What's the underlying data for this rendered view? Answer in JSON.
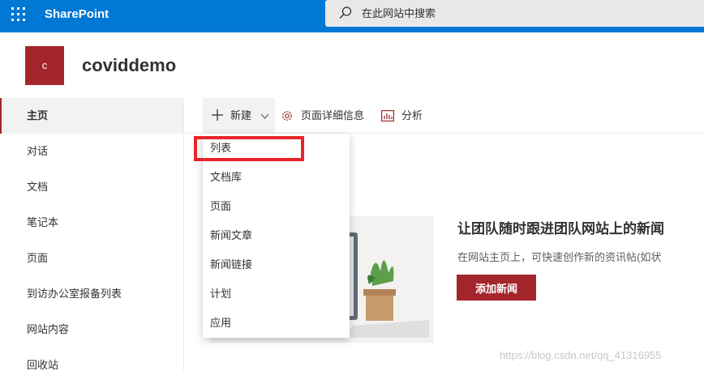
{
  "suite_bar": {
    "brand": "SharePoint",
    "search_placeholder": "在此网站中搜索",
    "accent_color": "#0078d4"
  },
  "site": {
    "logo_letter": "c",
    "title": "coviddemo",
    "theme_color": "#a4262c"
  },
  "left_nav": {
    "items": [
      {
        "label": "主页",
        "active": true
      },
      {
        "label": "对话"
      },
      {
        "label": "文档"
      },
      {
        "label": "笔记本"
      },
      {
        "label": "页面"
      },
      {
        "label": "到访办公室报备列表"
      },
      {
        "label": "网站内容"
      },
      {
        "label": "回收站"
      }
    ]
  },
  "command_bar": {
    "new_label": "新建",
    "page_details_label": "页面详细信息",
    "analytics_label": "分析",
    "icons": [
      "plus-icon",
      "chevron-down-icon",
      "gear-icon",
      "analytics-icon"
    ]
  },
  "new_menu": {
    "items": [
      "列表",
      "文档库",
      "页面",
      "新闻文章",
      "新闻链接",
      "计划",
      "应用"
    ],
    "highlighted_index": 0,
    "highlight_color": "#e8242a"
  },
  "news_hero": {
    "title": "让团队随时跟进团队网站上的新闻",
    "description": "在网站主页上，可快速创作新的资讯帖(如状",
    "button_label": "添加新闻"
  },
  "watermark": "https://blog.csdn.net/qq_41316955"
}
